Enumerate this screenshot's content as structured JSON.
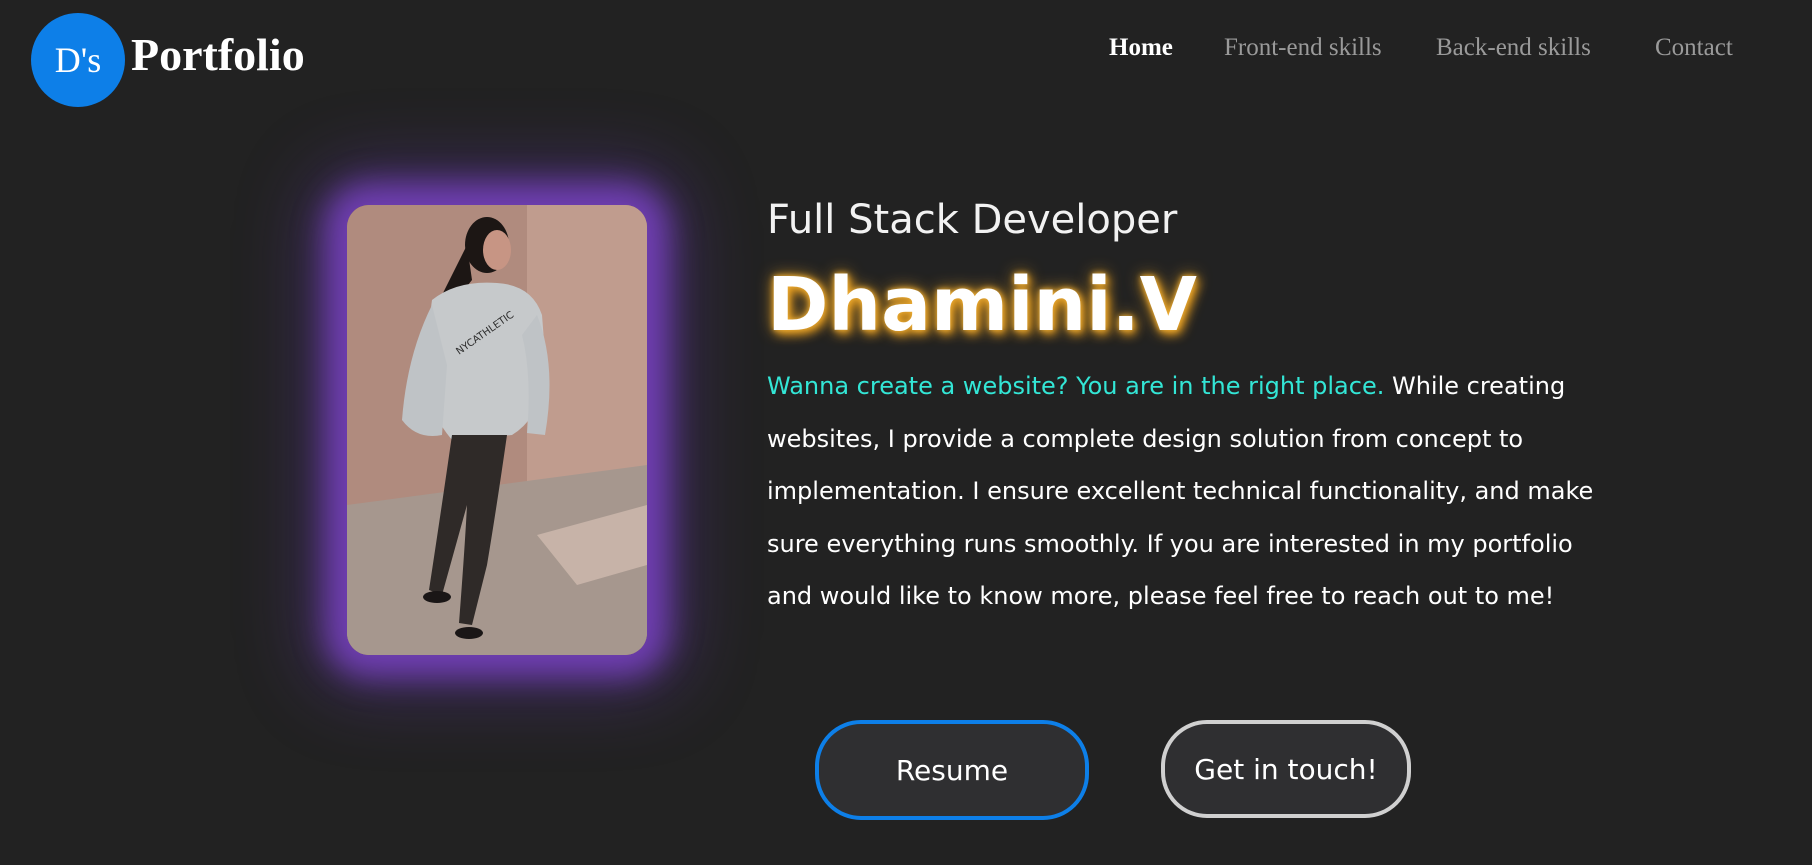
{
  "header": {
    "logo_initials": "D's",
    "logo_text": "Portfolio",
    "brand_color": "#0d7fe8"
  },
  "nav": {
    "items": [
      {
        "label": "Home",
        "active": true
      },
      {
        "label": "Front-end skills",
        "active": false
      },
      {
        "label": "Back-end skills",
        "active": false
      },
      {
        "label": "Contact",
        "active": false
      }
    ]
  },
  "hero": {
    "photo_icon": "profile-photo",
    "role": "Full Stack Developer",
    "name": "Dhamini.V",
    "highlight": "Wanna create a website? You are in the right place.",
    "description": " While creating websites, I provide a complete design solution from concept to implementation. I ensure excellent technical functionality, and make sure everything runs smoothly. If you are interested in my portfolio and would like to know more, please feel free to reach out to me!",
    "highlight_color": "#33e6d6",
    "glow_color": "#8246d2",
    "name_glow_color": "#e49a1c"
  },
  "actions": {
    "resume_label": "Resume",
    "contact_label": "Get in touch!",
    "resume_border_color": "#0d7fe8",
    "contact_border_color": "#d0d0d0"
  }
}
